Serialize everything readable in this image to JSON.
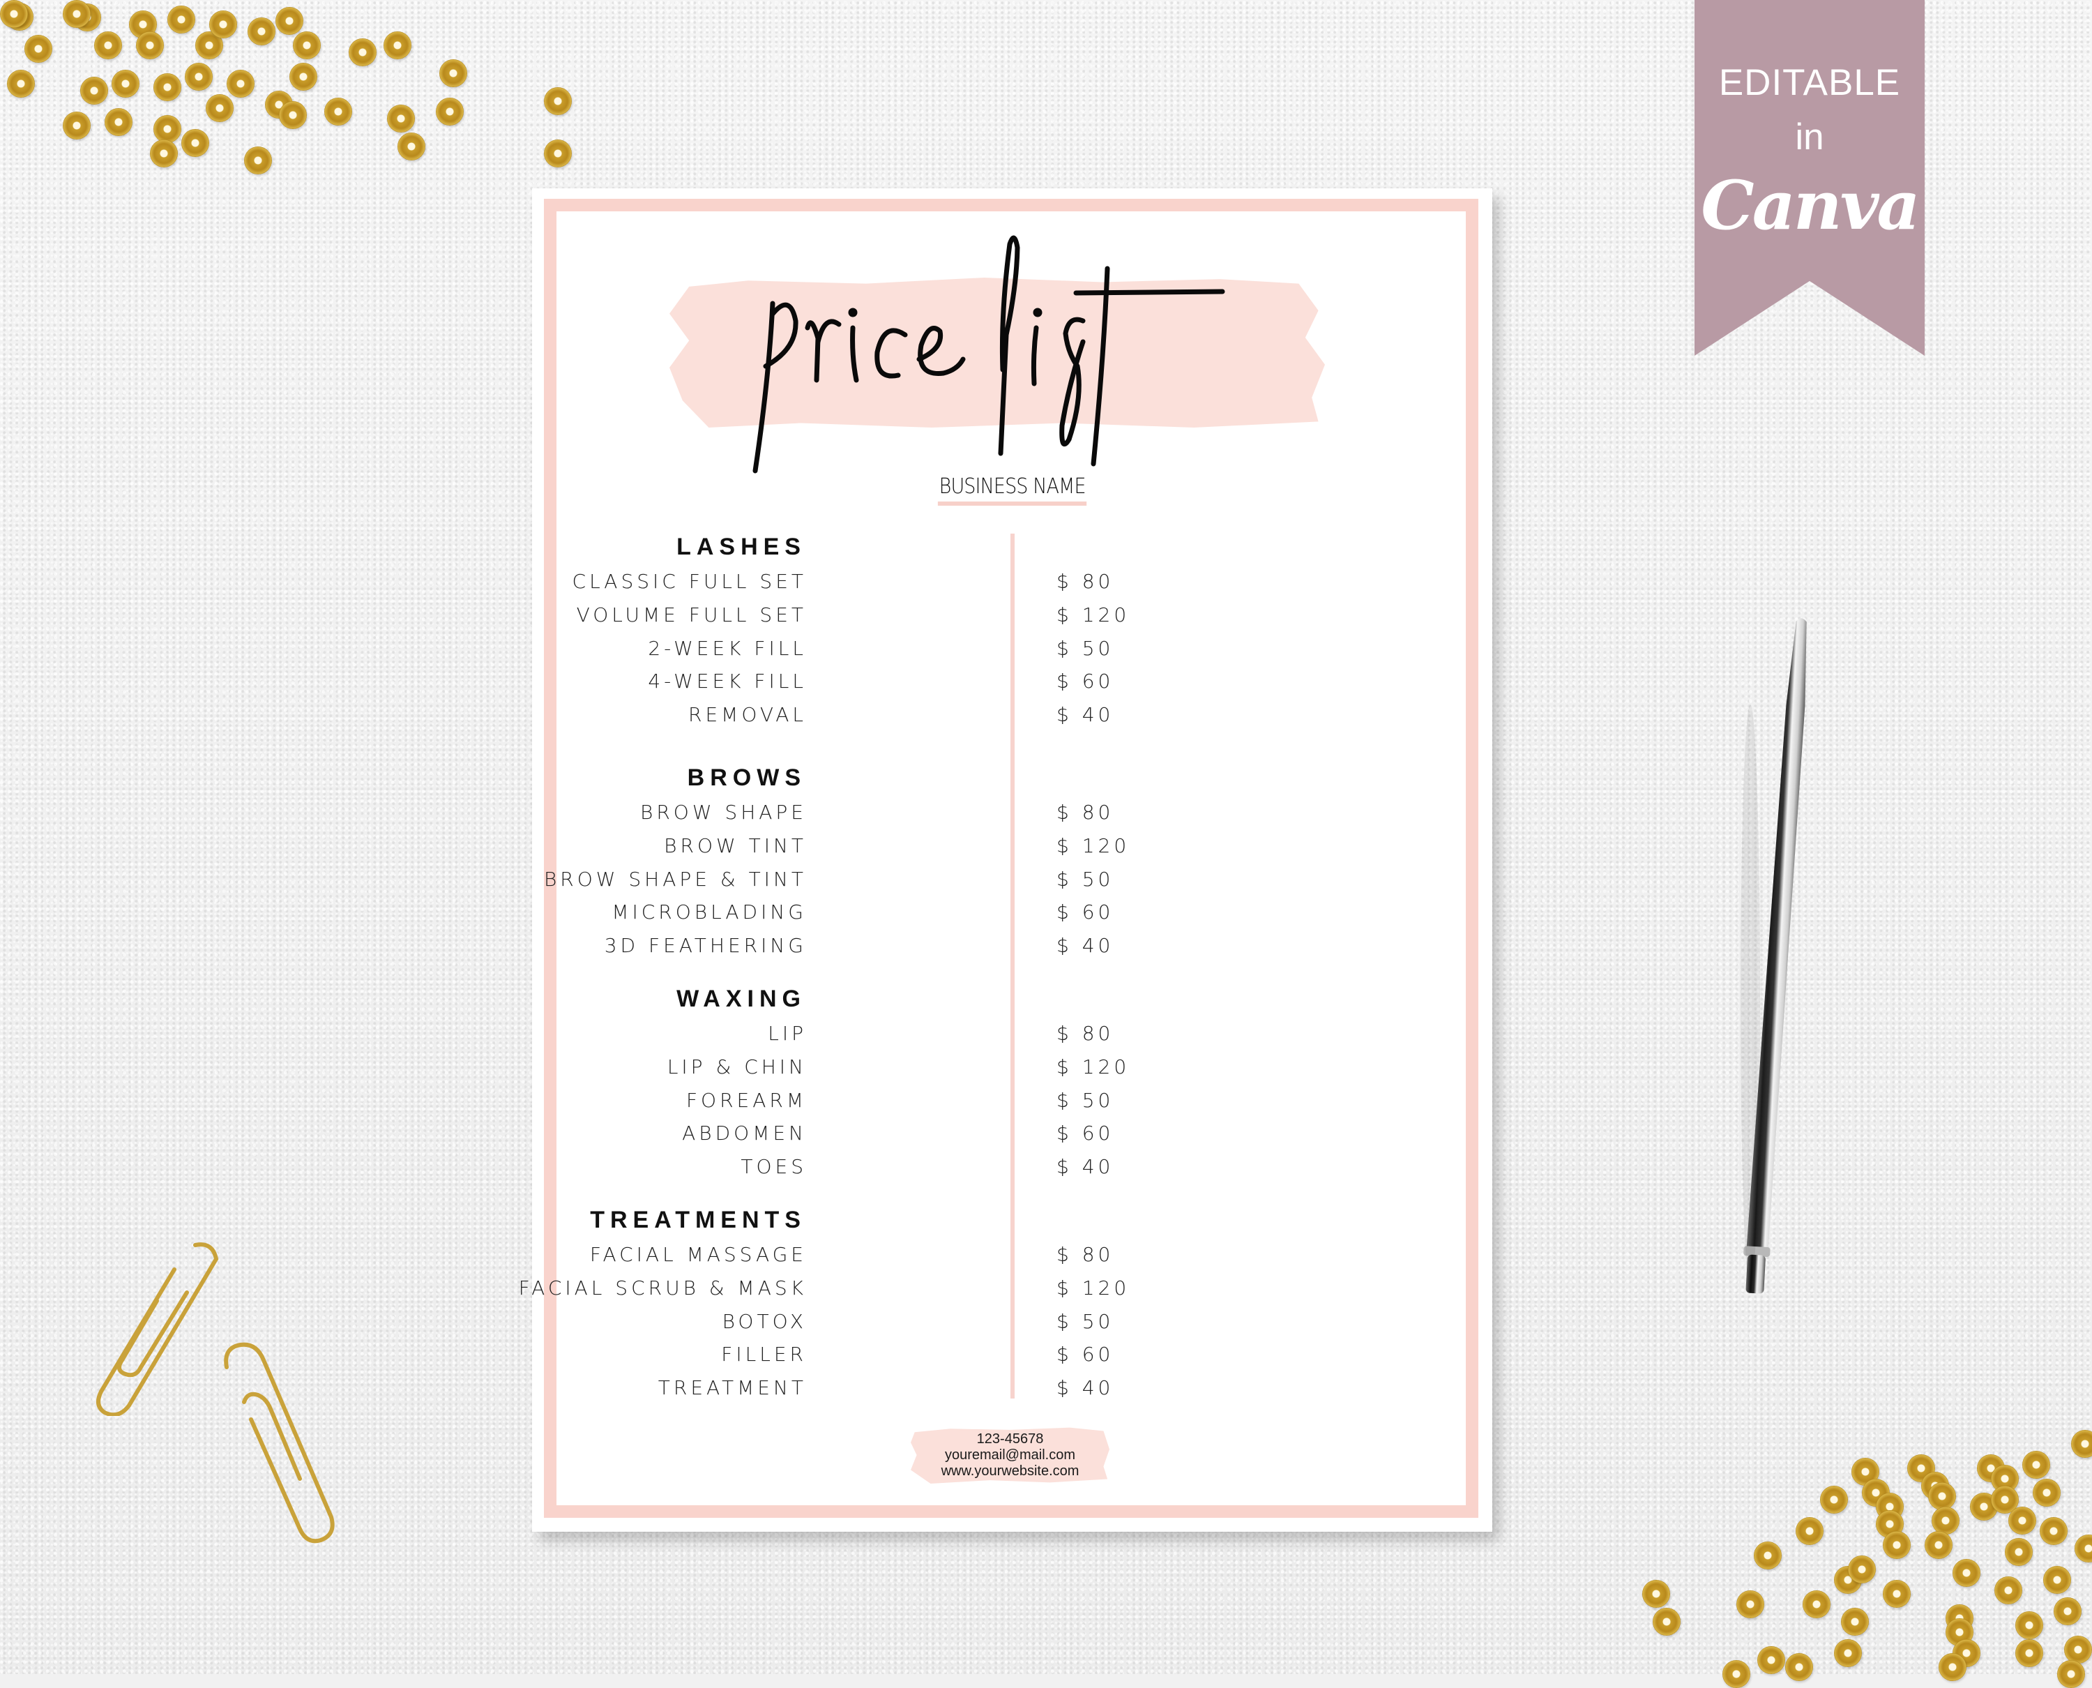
{
  "badge": {
    "line1": "EDITABLE",
    "line2": "in",
    "brand": "Canva",
    "color": "#b89aa4"
  },
  "card": {
    "title": "price list",
    "business_name": "BUSINESS NAME",
    "accent_color": "#f9d3cc",
    "sections": [
      {
        "heading": "LASHES",
        "items": [
          {
            "label": "CLASSIC FULL SET",
            "price": "$ 80"
          },
          {
            "label": "VOLUME FULL SET",
            "price": "$ 120"
          },
          {
            "label": "2-WEEK FILL",
            "price": "$ 50"
          },
          {
            "label": "4-WEEK FILL",
            "price": "$ 60"
          },
          {
            "label": "REMOVAL",
            "price": "$ 40"
          }
        ]
      },
      {
        "heading": "BROWS",
        "items": [
          {
            "label": "BROW SHAPE",
            "price": "$ 80"
          },
          {
            "label": "BROW TINT",
            "price": "$ 120"
          },
          {
            "label": "BROW SHAPE & TINT",
            "price": "$ 50"
          },
          {
            "label": "MICROBLADING",
            "price": "$ 60"
          },
          {
            "label": "3D FEATHERING",
            "price": "$ 40"
          }
        ]
      },
      {
        "heading": "WAXING",
        "items": [
          {
            "label": "LIP",
            "price": "$ 80"
          },
          {
            "label": "LIP & CHIN",
            "price": "$ 120"
          },
          {
            "label": "FOREARM",
            "price": "$ 50"
          },
          {
            "label": "ABDOMEN",
            "price": "$ 60"
          },
          {
            "label": "TOES",
            "price": "$ 40"
          }
        ]
      },
      {
        "heading": "TREATMENTS",
        "items": [
          {
            "label": "FACIAL MASSAGE",
            "price": "$ 80"
          },
          {
            "label": "FACIAL SCRUB & MASK",
            "price": "$ 120"
          },
          {
            "label": "BOTOX",
            "price": "$ 50"
          },
          {
            "label": "FILLER",
            "price": "$ 60"
          },
          {
            "label": "TREATMENT",
            "price": "$ 40"
          }
        ]
      }
    ],
    "contact": {
      "phone": "123-45678",
      "email": "youremail@mail.com",
      "website": "www.yourwebsite.com"
    }
  },
  "decor": {
    "sequin_color": "#c49a2a",
    "paperclip_color": "#c9a23a",
    "pen": "silver-pen"
  }
}
